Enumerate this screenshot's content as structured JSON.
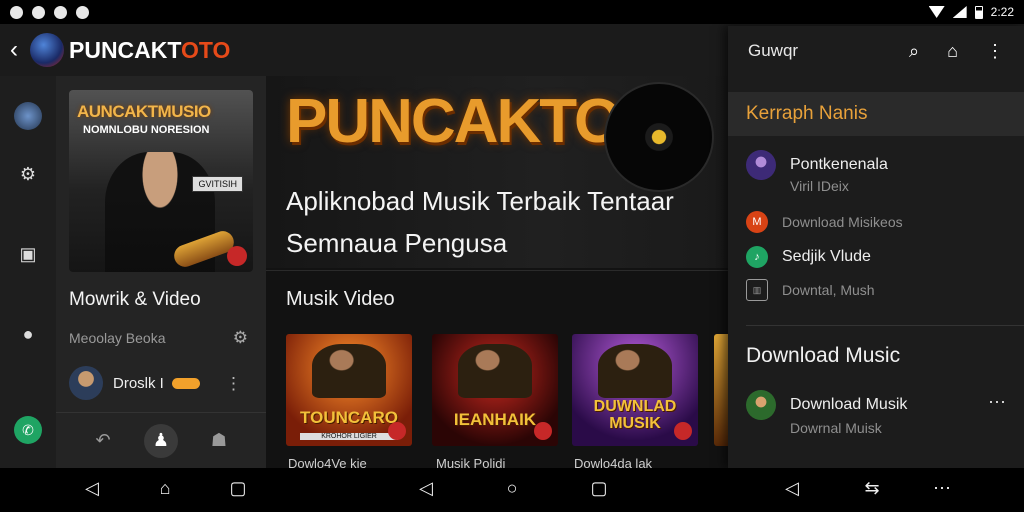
{
  "status_bar": {
    "time": "2:22"
  },
  "app_bar": {
    "brand_main": "PUNCAKT",
    "brand_accent": "OTO"
  },
  "rail": {
    "items": [
      {
        "icon": "avatar-icon"
      },
      {
        "icon": "settings-icon"
      },
      {
        "icon": "media-icon"
      },
      {
        "icon": "location-icon"
      },
      {
        "icon": "whatsapp-icon"
      }
    ]
  },
  "left_panel": {
    "album_title": "AUNCAKTMUSIO",
    "album_subtitle": "NOMNLOBU NORESION",
    "album_badge": "GVITISIH",
    "title": "Mowrik & Video",
    "subtitle": "Meoolay Beoka",
    "row_text": "Droslk I",
    "bottom_nav": [
      "back-icon",
      "user-icon",
      "profile-icon"
    ]
  },
  "hero": {
    "title": "PUNCAKTO",
    "subtitle_line1": "Apliknobad Musik Terbaik Tentaar",
    "subtitle_line2": "Semnaua Pengusa"
  },
  "section_title": "Musik Video",
  "videos": [
    {
      "label": "TOUNCARO",
      "tag": "KROHOR LIGIER",
      "caption": "Dowlo4Ve kie"
    },
    {
      "label": "IEANHAIK",
      "tag": "",
      "caption": "Musik Polidi"
    },
    {
      "label": "DUWNLAD MUSIK",
      "tag": "",
      "caption": "Dowlo4da lak"
    }
  ],
  "drawer": {
    "title": "Guwqr",
    "section": "Kerraph Nanis",
    "items": [
      {
        "label": "Pontkenenala",
        "style": "normal"
      },
      {
        "label": "Viril IDeix",
        "style": "dim"
      },
      {
        "label": "Download Misikeos",
        "style": "dim"
      },
      {
        "label": "Sedjik Vlude",
        "style": "normal"
      },
      {
        "label": "Downtal, Mush",
        "style": "dim"
      }
    ],
    "heading": "Download Music",
    "bottom_item": {
      "title": "Download Musik",
      "subtitle": "Dowrnal Muisk"
    }
  },
  "colors": {
    "accent": "#e8a13a",
    "brand_red": "#e64a19",
    "green": "#1fa463"
  }
}
